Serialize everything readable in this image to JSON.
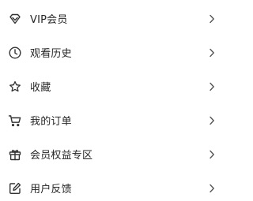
{
  "menu": {
    "items": [
      {
        "label": "VIP会员",
        "icon": "vip-diamond-icon"
      },
      {
        "label": "观看历史",
        "icon": "clock-icon"
      },
      {
        "label": "收藏",
        "icon": "star-icon"
      },
      {
        "label": "我的订单",
        "icon": "cart-icon"
      },
      {
        "label": "会员权益专区",
        "icon": "gift-icon"
      },
      {
        "label": "用户反馈",
        "icon": "edit-icon"
      }
    ]
  },
  "colors": {
    "text": "#262626",
    "icon": "#333333",
    "chevron": "#555555",
    "background": "#ffffff"
  }
}
